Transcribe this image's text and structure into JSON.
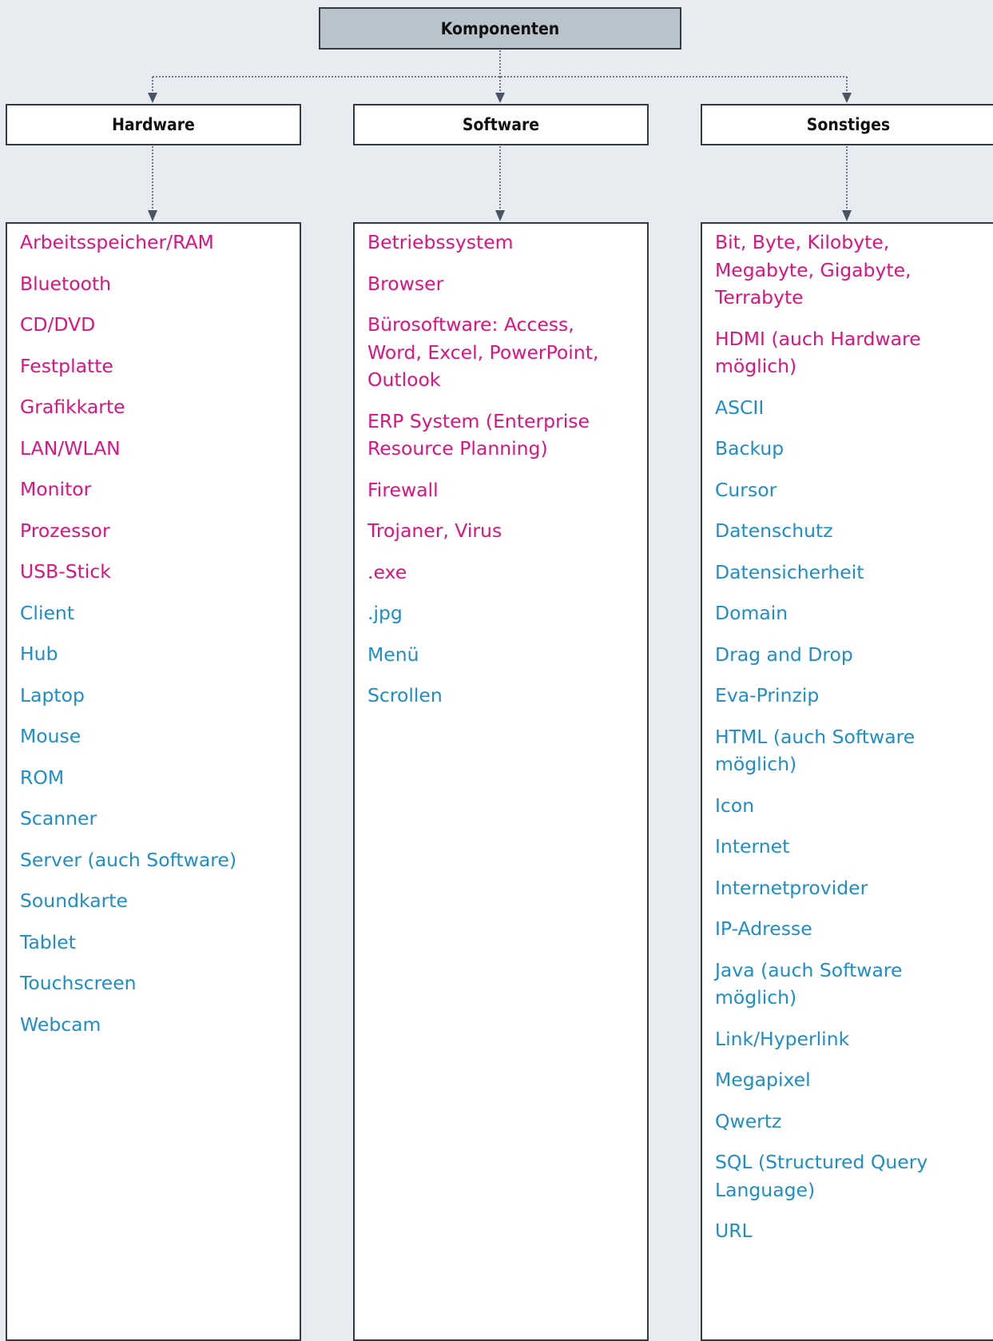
{
  "colors": {
    "background": "#e8ecf1",
    "root_fill": "#b9c3cc",
    "border": "#333a44",
    "connector": "#4a5563",
    "pink": "#e0127e",
    "blue": "#1d8ec9"
  },
  "root": {
    "label": "Komponenten"
  },
  "columns": [
    {
      "title": "Hardware",
      "items": [
        {
          "lines": [
            "Arbeitsspeicher/RAM"
          ],
          "color": "pink"
        },
        {
          "lines": [
            "Bluetooth"
          ],
          "color": "pink"
        },
        {
          "lines": [
            "CD/DVD"
          ],
          "color": "pink"
        },
        {
          "lines": [
            "Festplatte"
          ],
          "color": "pink"
        },
        {
          "lines": [
            "Grafikkarte"
          ],
          "color": "pink"
        },
        {
          "lines": [
            "LAN/WLAN"
          ],
          "color": "pink"
        },
        {
          "lines": [
            "Monitor"
          ],
          "color": "pink"
        },
        {
          "lines": [
            "Prozessor"
          ],
          "color": "pink"
        },
        {
          "lines": [
            "USB-Stick"
          ],
          "color": "pink"
        },
        {
          "lines": [
            "Client"
          ],
          "color": "blue"
        },
        {
          "lines": [
            "Hub"
          ],
          "color": "blue"
        },
        {
          "lines": [
            "Laptop"
          ],
          "color": "blue"
        },
        {
          "lines": [
            "Mouse"
          ],
          "color": "blue"
        },
        {
          "lines": [
            "ROM"
          ],
          "color": "blue"
        },
        {
          "lines": [
            "Scanner"
          ],
          "color": "blue"
        },
        {
          "lines": [
            "Server (auch Software)"
          ],
          "color": "blue"
        },
        {
          "lines": [
            "Soundkarte"
          ],
          "color": "blue"
        },
        {
          "lines": [
            "Tablet"
          ],
          "color": "blue"
        },
        {
          "lines": [
            "Touchscreen"
          ],
          "color": "blue"
        },
        {
          "lines": [
            "Webcam"
          ],
          "color": "blue"
        }
      ]
    },
    {
      "title": "Software",
      "items": [
        {
          "lines": [
            "Betriebssystem"
          ],
          "color": "pink"
        },
        {
          "lines": [
            "Browser"
          ],
          "color": "pink"
        },
        {
          "lines": [
            "Bürosoftware: Access,",
            "Word, Excel, PowerPoint,",
            "Outlook"
          ],
          "color": "pink"
        },
        {
          "lines": [
            "ERP System (Enterprise",
            "Resource Planning)"
          ],
          "color": "pink"
        },
        {
          "lines": [
            "Firewall"
          ],
          "color": "pink"
        },
        {
          "lines": [
            "Trojaner, Virus"
          ],
          "color": "pink"
        },
        {
          "lines": [
            ".exe"
          ],
          "color": "pink"
        },
        {
          "lines": [
            ".jpg"
          ],
          "color": "blue"
        },
        {
          "lines": [
            "Menü"
          ],
          "color": "blue"
        },
        {
          "lines": [
            "Scrollen"
          ],
          "color": "blue"
        }
      ]
    },
    {
      "title": "Sonstiges",
      "items": [
        {
          "lines": [
            "Bit, Byte, Kilobyte,",
            "Megabyte, Gigabyte,",
            "Terrabyte"
          ],
          "color": "pink"
        },
        {
          "lines": [
            "HDMI (auch Hardware",
            "möglich)"
          ],
          "color": "pink"
        },
        {
          "lines": [
            "ASCII"
          ],
          "color": "blue"
        },
        {
          "lines": [
            "Backup"
          ],
          "color": "blue"
        },
        {
          "lines": [
            "Cursor"
          ],
          "color": "blue"
        },
        {
          "lines": [
            "Datenschutz"
          ],
          "color": "blue"
        },
        {
          "lines": [
            "Datensicherheit"
          ],
          "color": "blue"
        },
        {
          "lines": [
            "Domain"
          ],
          "color": "blue"
        },
        {
          "lines": [
            "Drag and Drop"
          ],
          "color": "blue"
        },
        {
          "lines": [
            "Eva-Prinzip"
          ],
          "color": "blue"
        },
        {
          "lines": [
            "HTML (auch Software",
            "möglich)"
          ],
          "color": "blue"
        },
        {
          "lines": [
            "Icon"
          ],
          "color": "blue"
        },
        {
          "lines": [
            "Internet"
          ],
          "color": "blue"
        },
        {
          "lines": [
            "Internetprovider"
          ],
          "color": "blue"
        },
        {
          "lines": [
            "IP-Adresse"
          ],
          "color": "blue"
        },
        {
          "lines": [
            "Java (auch Software",
            "möglich)"
          ],
          "color": "blue"
        },
        {
          "lines": [
            "Link/Hyperlink"
          ],
          "color": "blue"
        },
        {
          "lines": [
            "Megapixel"
          ],
          "color": "blue"
        },
        {
          "lines": [
            "Qwertz"
          ],
          "color": "blue"
        },
        {
          "lines": [
            "SQL (Structured Query",
            "Language)"
          ],
          "color": "blue"
        },
        {
          "lines": [
            "URL"
          ],
          "color": "blue"
        }
      ]
    }
  ]
}
